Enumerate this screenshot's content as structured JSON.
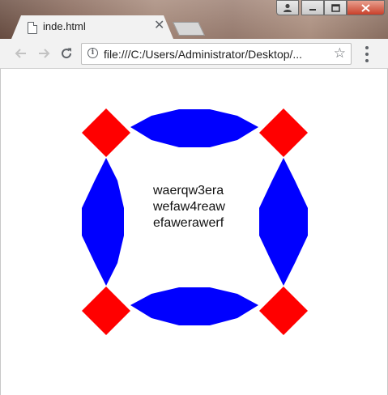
{
  "tab": {
    "title": "inde.html"
  },
  "toolbar": {
    "url": "file:///C:/Users/Administrator/Desktop/..."
  },
  "page": {
    "text_lines": [
      "waerqw3era",
      "wefaw4reaw",
      "efawerawerf"
    ]
  },
  "colors": {
    "diamond": "#ff0000",
    "bar": "#0000ff"
  },
  "icons": [
    "page-icon",
    "close-icon",
    "user-icon",
    "minimize-icon",
    "maximize-icon",
    "window-close-icon",
    "back-icon",
    "forward-icon",
    "reload-icon",
    "info-icon",
    "star-icon",
    "menu-icon"
  ]
}
